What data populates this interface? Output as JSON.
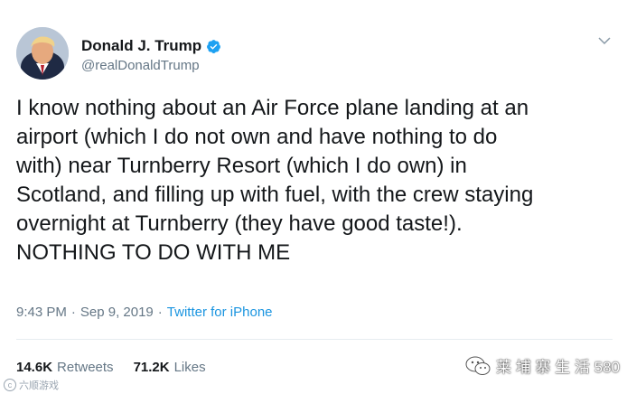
{
  "tweet": {
    "author": {
      "display_name": "Donald J. Trump",
      "handle": "@realDonaldTrump",
      "verified": true
    },
    "text": "I know nothing about an Air Force plane landing at an\nairport (which I do not own and have nothing to do\nwith) near Turnberry Resort (which I do own) in\nScotland, and filling up with fuel, with the crew staying\novernight at Turnberry (they have good taste!).\nNOTHING TO DO WITH ME",
    "time": "9:43 PM",
    "date": "Sep 9, 2019",
    "separator": "·",
    "source": "Twitter for iPhone",
    "stats": {
      "retweets_count": "14.6K",
      "retweets_label": "Retweets",
      "likes_count": "71.2K",
      "likes_label": "Likes"
    }
  },
  "watermarks": {
    "channel": "莱 埔 寨 生 活 580",
    "corner": "六顺游戏"
  },
  "colors": {
    "verified": "#1da1f2",
    "secondary_text": "#657786",
    "link": "#1b95e0"
  },
  "icons": {
    "verified": "verified-badge-icon",
    "menu": "chevron-down-icon",
    "watermark": "wechat-icon"
  }
}
